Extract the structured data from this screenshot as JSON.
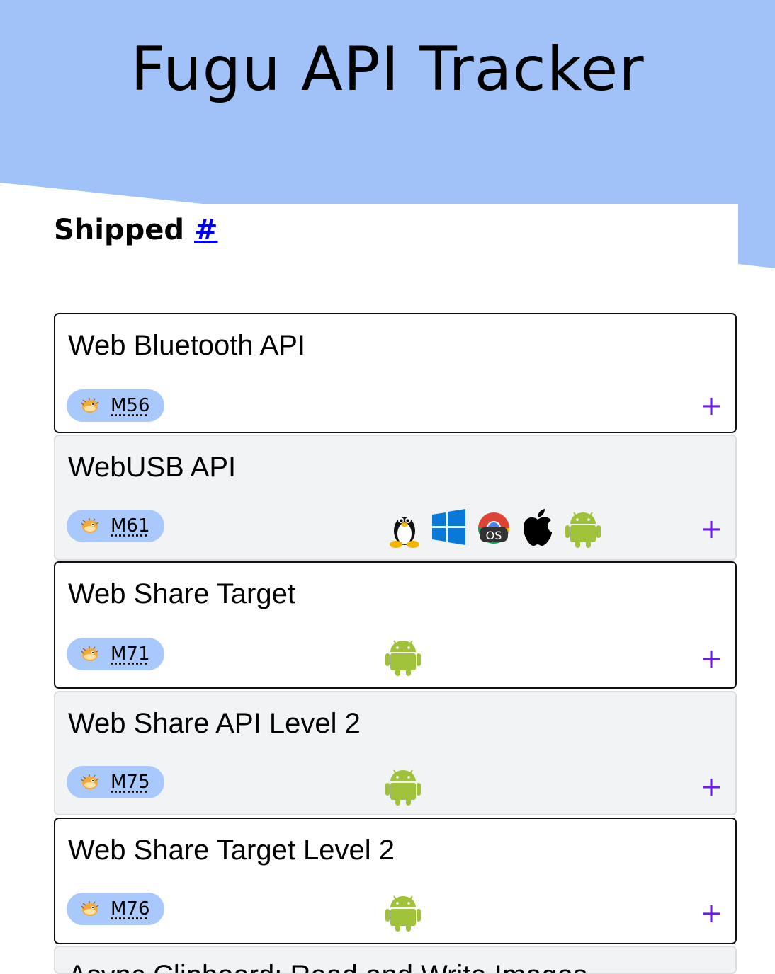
{
  "header": {
    "title": "Fugu API Tracker"
  },
  "section": {
    "title": "Shipped",
    "anchor": "#"
  },
  "apis": [
    {
      "name": "Web Bluetooth API",
      "milestone": "M56",
      "platforms": []
    },
    {
      "name": "WebUSB API",
      "milestone": "M61",
      "platforms": [
        "linux-icon",
        "windows-icon",
        "chromeos-icon",
        "apple-icon",
        "android-icon"
      ]
    },
    {
      "name": "Web Share Target",
      "milestone": "M71",
      "platforms": [
        "android-icon"
      ]
    },
    {
      "name": "Web Share API Level 2",
      "milestone": "M75",
      "platforms": [
        "android-icon"
      ]
    },
    {
      "name": "Web Share Target Level 2",
      "milestone": "M76",
      "platforms": [
        "android-icon"
      ]
    },
    {
      "name": "Async Clipboard: Read and Write Images",
      "milestone": "",
      "platforms": []
    }
  ],
  "expand_symbol": "+",
  "colors": {
    "header": "#a0c2f9",
    "pill": "#a9c8fb",
    "plus": "#6a1ee0",
    "android": "#9fc23a"
  }
}
